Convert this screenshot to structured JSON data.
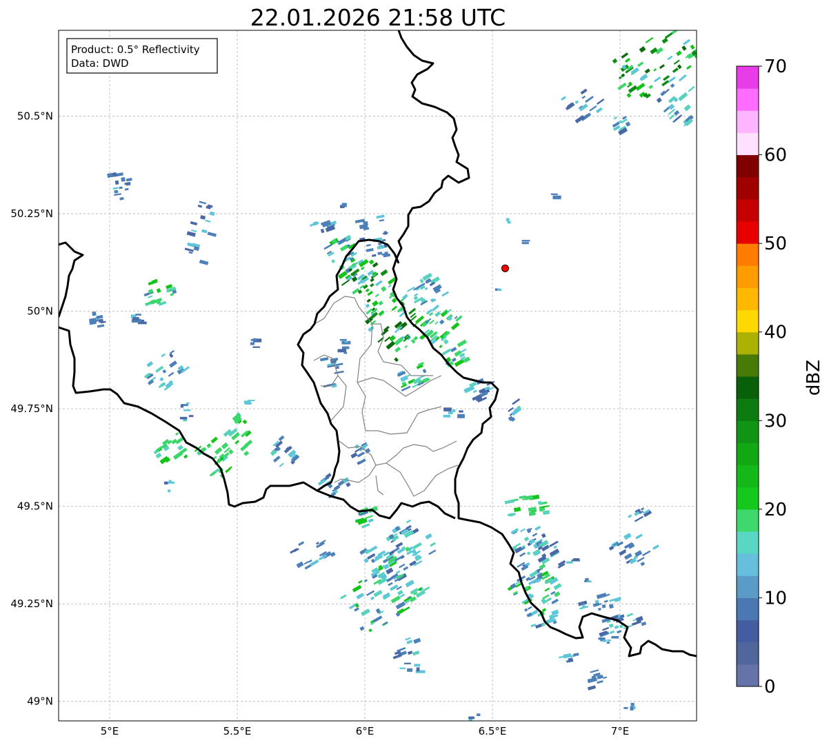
{
  "title": "22.01.2026 21:58 UTC",
  "info_box": {
    "line1": "Product: 0.5° Reflectivity",
    "line2": "Data: DWD"
  },
  "map": {
    "lon_range": [
      4.8,
      7.3
    ],
    "lat_range": [
      48.95,
      50.72
    ],
    "x_ticks": [
      {
        "value": 5.0,
        "label": "5°E"
      },
      {
        "value": 5.5,
        "label": "5.5°E"
      },
      {
        "value": 6.0,
        "label": "6°E"
      },
      {
        "value": 6.5,
        "label": "6.5°E"
      },
      {
        "value": 7.0,
        "label": "7°E"
      }
    ],
    "y_ticks": [
      {
        "value": 49.0,
        "label": "49°N"
      },
      {
        "value": 49.25,
        "label": "49.25°N"
      },
      {
        "value": 49.5,
        "label": "49.5°N"
      },
      {
        "value": 49.75,
        "label": "49.75°N"
      },
      {
        "value": 50.0,
        "label": "50°N"
      },
      {
        "value": 50.25,
        "label": "50.25°N"
      },
      {
        "value": 50.5,
        "label": "50.5°N"
      }
    ],
    "grid": true,
    "radar_site": {
      "lon": 6.55,
      "lat": 50.11,
      "color": "#ff0000"
    }
  },
  "colorbar": {
    "label": "dBZ",
    "min": 0,
    "max": 70,
    "tick_labels": [
      {
        "value": 0,
        "label": "0"
      },
      {
        "value": 10,
        "label": "10"
      },
      {
        "value": 20,
        "label": "20"
      },
      {
        "value": 30,
        "label": "30"
      },
      {
        "value": 40,
        "label": "40"
      },
      {
        "value": 50,
        "label": "50"
      },
      {
        "value": 60,
        "label": "60"
      },
      {
        "value": 70,
        "label": "70"
      }
    ],
    "colors": [
      "#6673a8",
      "#52669e",
      "#445da0",
      "#4b78b2",
      "#5a9bc8",
      "#66c0dd",
      "#5ad6c4",
      "#3ed86c",
      "#14c81c",
      "#14b818",
      "#12a814",
      "#109414",
      "#0c7c10",
      "#086008",
      "#487a08",
      "#acb204",
      "#ffd800",
      "#ffb800",
      "#ff9c00",
      "#ff7c00",
      "#e80000",
      "#c40000",
      "#a00000",
      "#800000",
      "#ffe0ff",
      "#ffb4ff",
      "#ff6cff",
      "#e83ce8"
    ]
  },
  "palette": {
    "blue_dark": "#4a68a6",
    "blue": "#4d7fb8",
    "cyan": "#5ec6d8",
    "teal": "#58d2bc",
    "green_light": "#3cd66c",
    "green": "#14c41a",
    "green_dark": "#0e8c14",
    "green_deeper": "#0a6a0c",
    "border": "#000000",
    "inner_border": "#808080"
  }
}
